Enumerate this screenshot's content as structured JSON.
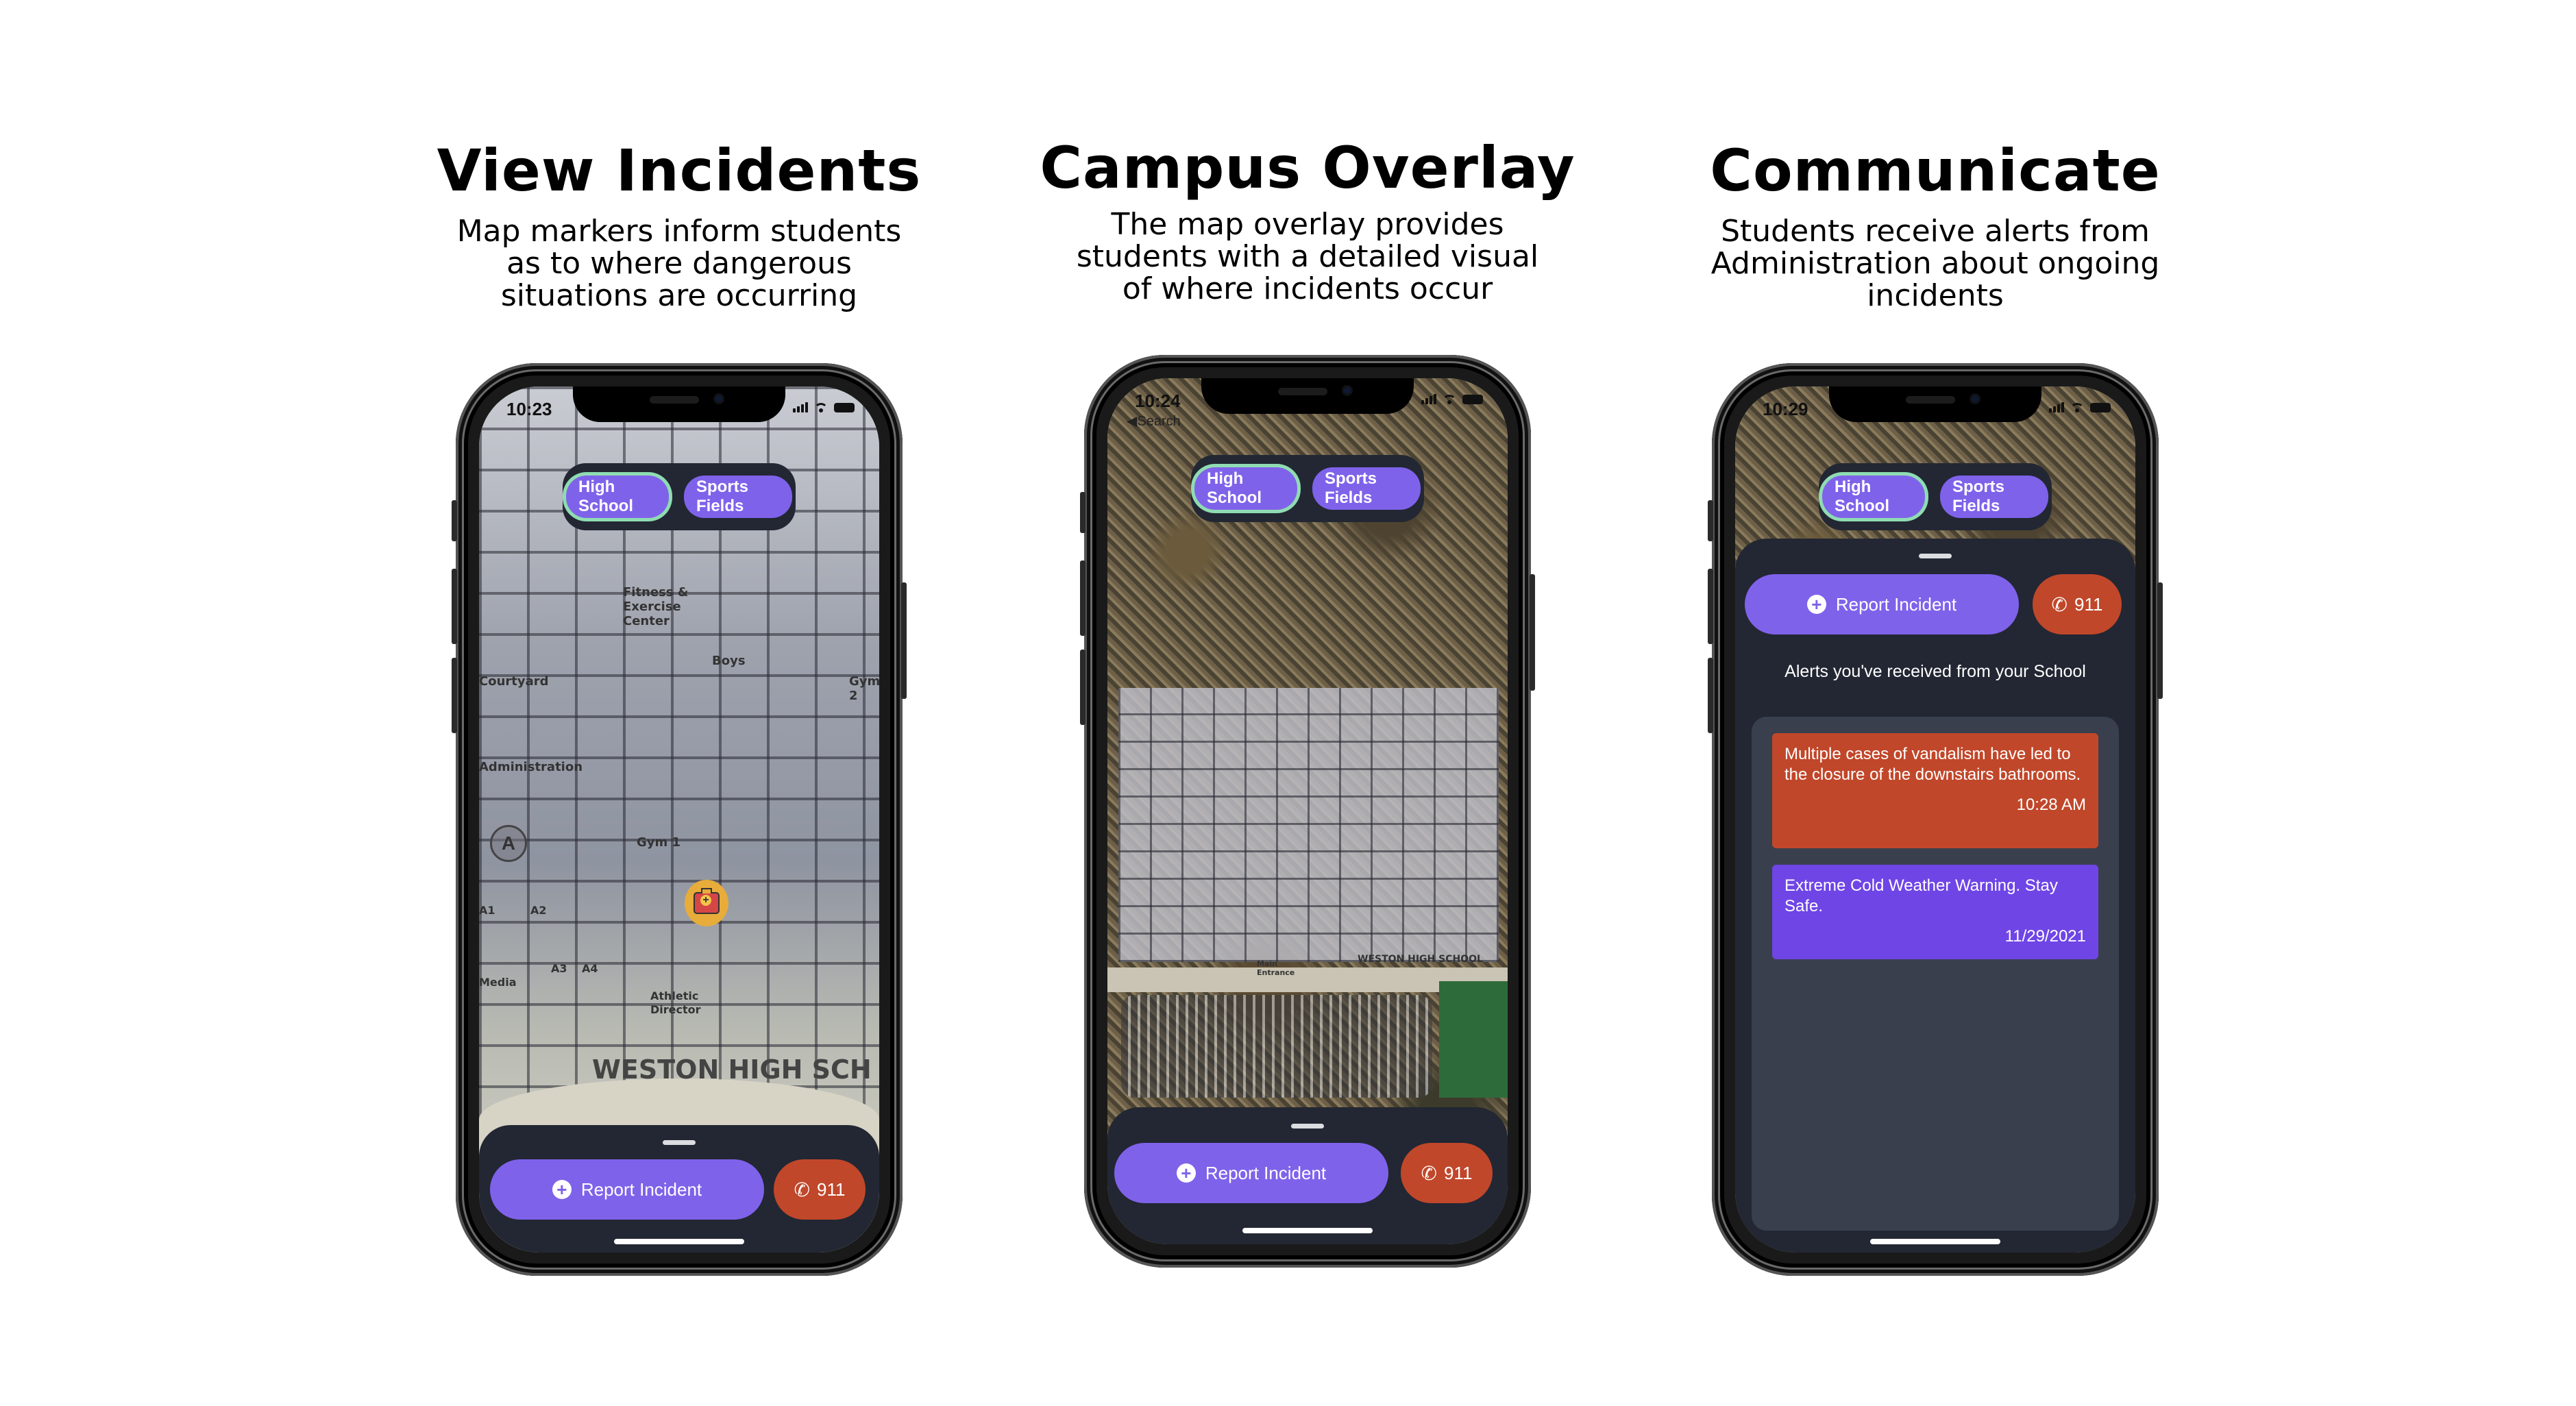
{
  "features": [
    {
      "title": "View Incidents",
      "description_lines": [
        "Map markers inform students",
        "as to where dangerous",
        "situations are occurring"
      ]
    },
    {
      "title": "Campus Overlay",
      "description_lines": [
        "The map overlay provides",
        "students with a detailed visual",
        "of where incidents occur"
      ]
    },
    {
      "title": "Communicate",
      "description_lines": [
        "Students receive alerts from",
        "Administration about ongoing",
        "incidents"
      ]
    }
  ],
  "phones": [
    {
      "status_time": "10:23",
      "map_labels": [
        "Fitness & Exercise Center",
        "Boys",
        "Gym 2",
        "Courtyard",
        "Administration",
        "Gym 1",
        "A1",
        "A2",
        "A3",
        "A4",
        "Media",
        "Athletic Director",
        "WESTON HIGH SCH"
      ],
      "incident_marker": "first-aid-kit",
      "building_marker": "A"
    },
    {
      "status_time": "10:24",
      "back_label": "Search",
      "map_labels": [
        "WESTON HIGH SCHOOL",
        "Main Entrance"
      ]
    },
    {
      "status_time": "10:29"
    }
  ],
  "common": {
    "campus_tabs": [
      {
        "label": "High School",
        "selected": true
      },
      {
        "label": "Sports Fields",
        "selected": false
      }
    ],
    "report_button": "Report Incident",
    "emergency_button": "911"
  },
  "alerts": {
    "title": "Alerts you've received from your School",
    "items": [
      {
        "message": "Multiple cases of vandalism have led to the closure of the downstairs bathrooms.",
        "time": "10:28 AM",
        "color": "#c1472a"
      },
      {
        "message": "Extreme Cold Weather Warning. Stay Safe.",
        "time": "11/29/2021",
        "color": "#6f45e6"
      }
    ]
  },
  "colors": {
    "accent_purple": "#7f62ea",
    "emergency_red": "#c1472a",
    "selected_outline": "#8fdcb2",
    "sheet_bg": "#222733",
    "marker_yellow": "#e8ac3b"
  }
}
